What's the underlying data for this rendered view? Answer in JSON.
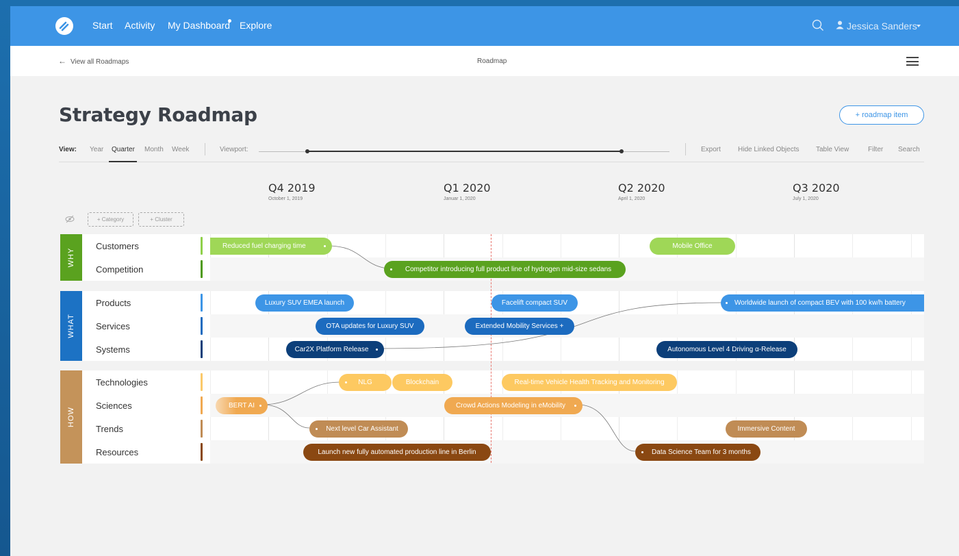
{
  "nav": {
    "links": [
      "Start",
      "Activity",
      "My Dashboard",
      "Explore"
    ],
    "user": "Jessica Sanders"
  },
  "subbar": {
    "back": "View all Roadmaps",
    "title": "Roadmap"
  },
  "page": {
    "title": "Strategy Roadmap",
    "add_button": "+ roadmap item"
  },
  "toolbar": {
    "view_label": "View:",
    "views": [
      "Year",
      "Quarter",
      "Month",
      "Week"
    ],
    "active_view": "Quarter",
    "viewport_label": "Viewport:",
    "actions": [
      "Export",
      "Hide Linked Objects",
      "Table View",
      "Filter",
      "Search"
    ]
  },
  "quarters": [
    {
      "label": "Q4 2019",
      "date": "October 1, 2019"
    },
    {
      "label": "Q1 2020",
      "date": "Januar 1, 2020"
    },
    {
      "label": "Q2 2020",
      "date": "April 1, 2020"
    },
    {
      "label": "Q3 2020",
      "date": "July 1, 2020"
    }
  ],
  "controls": {
    "add_category": "+ Category",
    "add_cluster": "+ Cluster"
  },
  "groups": [
    {
      "name": "WHY",
      "color": "#5aa21f",
      "rows": [
        "Customers",
        "Competition"
      ],
      "row_colors": [
        "#8fd04a",
        "#4e9a12"
      ]
    },
    {
      "name": "WHAT",
      "color": "#1c72c4",
      "rows": [
        "Products",
        "Services",
        "Systems"
      ],
      "row_colors": [
        "#3d95e6",
        "#1c6bbf",
        "#0c3f7a"
      ]
    },
    {
      "name": "HOW",
      "color": "#c4935a",
      "rows": [
        "Technologies",
        "Sciences",
        "Trends",
        "Resources"
      ],
      "row_colors": [
        "#fbc96a",
        "#f0a951",
        "#c08c55",
        "#8a4812"
      ]
    }
  ],
  "items": [
    {
      "label": "Reduced fuel charging time",
      "color": "#9fd757"
    },
    {
      "label": "Mobile Office",
      "color": "#9fd757"
    },
    {
      "label": "Competitor introducing full product line of hydrogen mid-size sedans",
      "color": "#5aa21f"
    },
    {
      "label": "Luxury SUV EMEA launch",
      "color": "#3d95e6"
    },
    {
      "label": "Facelift compact SUV",
      "color": "#3d95e6"
    },
    {
      "label": "Worldwide launch of compact BEV with 100 kw/h battery",
      "color": "#3d95e6"
    },
    {
      "label": "OTA updates for Luxury SUV",
      "color": "#1c6bbf"
    },
    {
      "label": "Extended Mobility Services +",
      "color": "#1c6bbf"
    },
    {
      "label": "Car2X Platform Release",
      "color": "#0c3f7a"
    },
    {
      "label": "Autonomous Level 4 Driving α-Release",
      "color": "#0c3f7a"
    },
    {
      "label": "NLG",
      "color": "#fdc961"
    },
    {
      "label": "Blockchain",
      "color": "#fdc961"
    },
    {
      "label": "Real-time Vehicle Health Tracking and Monitoring",
      "color": "#fdc961"
    },
    {
      "label": "BERT AI",
      "color": "#f0a951"
    },
    {
      "label": "Crowd Actions Modeling in eMobility",
      "color": "#f0a951"
    },
    {
      "label": "Next level Car Assistant",
      "color": "#c08c55"
    },
    {
      "label": "Immersive Content",
      "color": "#c08c55"
    },
    {
      "label": "Launch new fully automated production line in Berlin",
      "color": "#8a4812"
    },
    {
      "label": "Data Science Team for 3 months",
      "color": "#8a4812"
    }
  ]
}
